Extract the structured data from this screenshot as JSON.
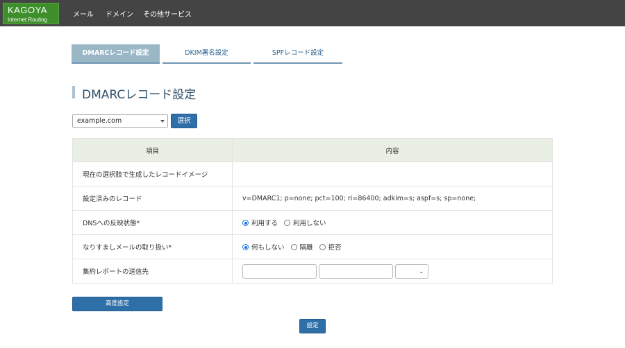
{
  "header": {
    "logo_line1": "KAGOYA",
    "logo_line2": "Internet Routing",
    "nav": [
      "メール",
      "ドメイン",
      "その他サービス"
    ]
  },
  "tabs": [
    {
      "label": "DMARCレコード設定",
      "active": true
    },
    {
      "label": "DKIM署名設定",
      "active": false
    },
    {
      "label": "SPFレコード設定",
      "active": false
    }
  ],
  "page_title": "DMARCレコード設定",
  "domain_select": {
    "value": "example.com",
    "button": "選択"
  },
  "table": {
    "headers": [
      "項目",
      "内容"
    ],
    "rows": [
      {
        "label": "現在の選択肢で生成したレコードイメージ",
        "value": ""
      },
      {
        "label": "設定済みのレコード",
        "value": "v=DMARC1; p=none; pct=100; ri=86400; adkim=s; aspf=s; sp=none;"
      },
      {
        "label": "DNSへの反映状態*",
        "options": [
          "利用する",
          "利用しない"
        ],
        "selected": 0
      },
      {
        "label": "なりすましメールの取り扱い*",
        "options": [
          "何もしない",
          "隔離",
          "拒否"
        ],
        "selected": 0
      },
      {
        "label": "集約レポートの送信先"
      }
    ]
  },
  "buttons": {
    "advanced": "高度設定",
    "submit": "設定"
  },
  "colors": {
    "header_bg": "#444444",
    "logo_green": "#3e8e2b",
    "primary_blue": "#2f6fa8",
    "tab_active": "#9ab7c6",
    "table_head": "#e9efe2"
  }
}
